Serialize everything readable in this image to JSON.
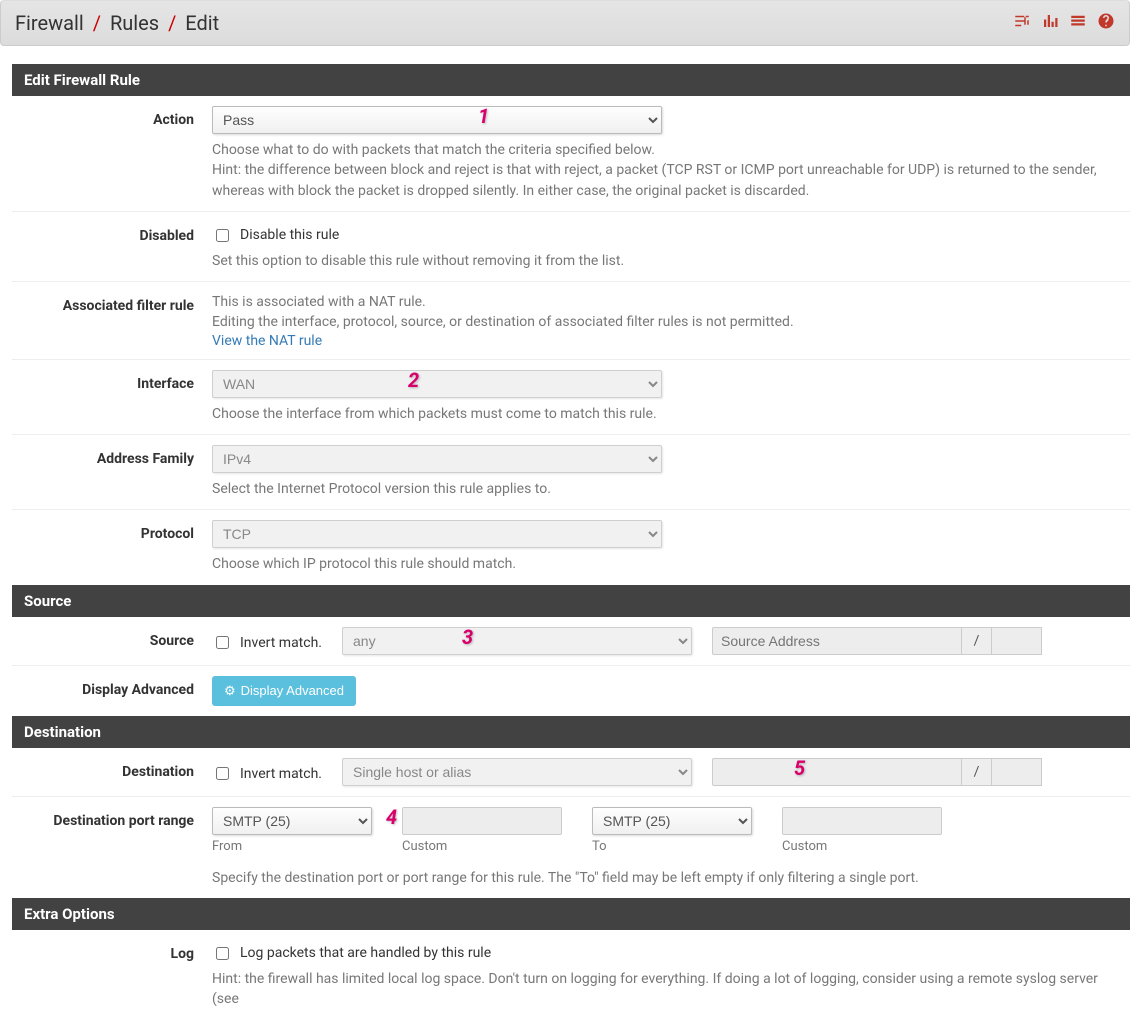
{
  "breadcrumb": {
    "part1": "Firewall",
    "part2": "Rules",
    "part3": "Edit"
  },
  "annotations": {
    "n1": "1",
    "n2": "2",
    "n3": "3",
    "n4": "4",
    "n5": "5"
  },
  "panels": {
    "edit": {
      "title": "Edit Firewall Rule"
    },
    "source": {
      "title": "Source"
    },
    "destination": {
      "title": "Destination"
    },
    "extra": {
      "title": "Extra Options"
    }
  },
  "action": {
    "label": "Action",
    "value": "Pass",
    "help": "Choose what to do with packets that match the criteria specified below.\nHint: the difference between block and reject is that with reject, a packet (TCP RST or ICMP port unreachable for UDP) is returned to the sender, whereas with block the packet is dropped silently. In either case, the original packet is discarded."
  },
  "disabled": {
    "label": "Disabled",
    "checkbox": "Disable this rule",
    "help": "Set this option to disable this rule without removing it from the list."
  },
  "associated": {
    "label": "Associated filter rule",
    "line1": "This is associated with a NAT rule.",
    "line2": "Editing the interface, protocol, source, or destination of associated filter rules is not permitted.",
    "link": "View the NAT rule"
  },
  "interface": {
    "label": "Interface",
    "value": "WAN",
    "help": "Choose the interface from which packets must come to match this rule."
  },
  "address_family": {
    "label": "Address Family",
    "value": "IPv4",
    "help": "Select the Internet Protocol version this rule applies to."
  },
  "protocol": {
    "label": "Protocol",
    "value": "TCP",
    "help": "Choose which IP protocol this rule should match."
  },
  "source": {
    "label": "Source",
    "invert": "Invert match.",
    "type_value": "any",
    "addr_placeholder": "Source Address",
    "slash": "/"
  },
  "display_adv": {
    "label": "Display Advanced",
    "button": "Display Advanced"
  },
  "destination": {
    "label": "Destination",
    "invert": "Invert match.",
    "type_value": "Single host or alias",
    "slash": "/"
  },
  "dest_port": {
    "label": "Destination port range",
    "from_value": "SMTP (25)",
    "to_value": "SMTP (25)",
    "from_label": "From",
    "custom_label": "Custom",
    "to_label": "To",
    "help": "Specify the destination port or port range for this rule. The \"To\" field may be left empty if only filtering a single port."
  },
  "log": {
    "label": "Log",
    "checkbox": "Log packets that are handled by this rule",
    "help": "Hint: the firewall has limited local log space. Don't turn on logging for everything. If doing a lot of logging, consider using a remote syslog server (see"
  }
}
